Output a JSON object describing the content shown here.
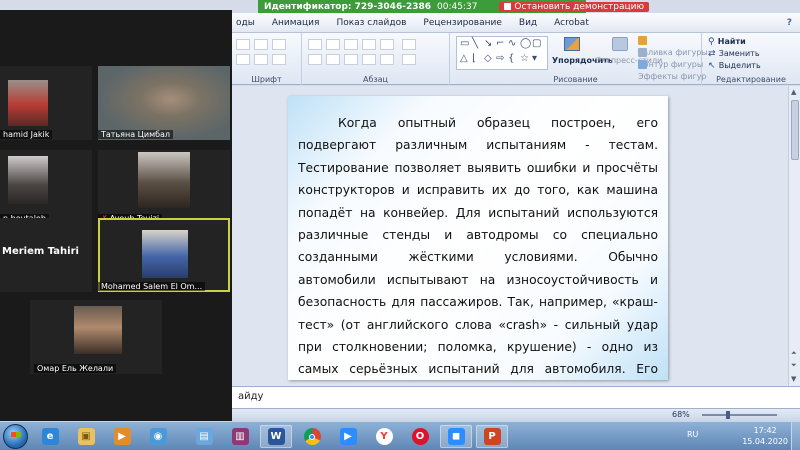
{
  "share_bar": {
    "meeting_id": "Идентификатор: 729-3046-2386",
    "timer": "00:45:37",
    "stop_label": "Остановить демонстрацию"
  },
  "menu": {
    "tabs": [
      "оды",
      "Анимация",
      "Показ слайдов",
      "Рецензирование",
      "Вид",
      "Acrobat"
    ],
    "help_icon": "help-icon"
  },
  "ribbon": {
    "groups": {
      "font": "Шрифт",
      "paragraph": "Абзац",
      "drawing": "Рисование",
      "editing": "Редактирование"
    },
    "arrange": "Упорядочить",
    "express_styles": "Экспресс-стили",
    "fill": "Заливка фигуры",
    "outline": "Контур фигуры",
    "effects": "Эффекты фигур",
    "find": "Найти",
    "replace": "Заменить",
    "select": "Выделить"
  },
  "slide": {
    "text": "Когда опытный образец построен, его подвергают различным испытаниям - тестам. Тестирование позволяет выявить ошибки и просчёты конструкторов и исправить их до того, как машина попадёт на конвейер. Для испытаний используются различные стенды и автодромы со специально созданными жёсткими условиями. Обычно автомобили испытывают на износоустойчивость и безопасность для пассажиров. Так, например, «краш-тест» (от английского слова «crash» - сильный удар при столкновении; поломка, крушение) - одно из самых серьёзных испытаний для автомобиля. Его корпус, узлы и агрегаты проверяются при лобовом и боковом столкновении на значительной скорости. При этом отдельно оценивается безопасность пассажиров, в особенности детей."
  },
  "notes": {
    "text": "айду"
  },
  "status": {
    "zoom": "68%",
    "zoom_fraction": 0.32
  },
  "participants": [
    {
      "name": "hamid Jakik"
    },
    {
      "name": "Татьяна Цимбал"
    },
    {
      "name": "n boutaleb"
    },
    {
      "name": "Ayoub Touizi"
    },
    {
      "name": "Meriem Tahiri"
    },
    {
      "name": "Mohamed Salem El Om..."
    },
    {
      "name": "Омар Ель Желали"
    }
  ],
  "taskbar": {
    "apps": [
      "start-icon",
      "ie-icon",
      "explorer-icon",
      "media-player-icon",
      "screen-capture-icon",
      "photo-viewer-icon",
      "winrar-icon",
      "word-icon",
      "chrome-icon",
      "zoom-icon",
      "yandex-icon",
      "opera-icon",
      "zoom-meeting-icon",
      "powerpoint-icon"
    ],
    "lang": "RU",
    "time": "17:42",
    "date": "15.04.2020"
  }
}
